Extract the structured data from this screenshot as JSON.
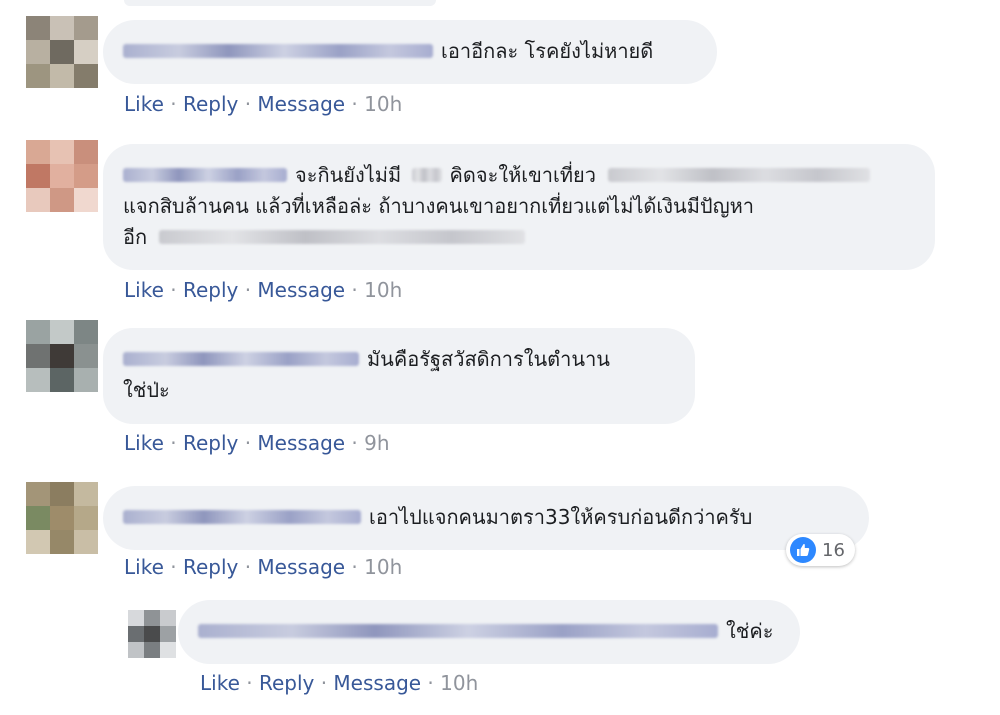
{
  "comments": [
    {
      "text_lines": [
        "เอาอีกละ โรคยังไม่หายดี"
      ],
      "actions": {
        "like": "Like",
        "reply": "Reply",
        "message": "Message",
        "time": "10h"
      }
    },
    {
      "text_lines": [
        "จะกินยังไม่มี",
        "คิดจะให้เขาเที่ยว",
        "แจกสิบล้านคน แล้วที่เหลือล่ะ ถ้าบางคนเขาอยากเที่ยวแต่ไม่ได้เงินมีปัญหา",
        "อีก"
      ],
      "actions": {
        "like": "Like",
        "reply": "Reply",
        "message": "Message",
        "time": "10h"
      }
    },
    {
      "text_lines": [
        "มันคือรัฐสวัสดิการในตำนาน",
        "ใช่ป่ะ"
      ],
      "actions": {
        "like": "Like",
        "reply": "Reply",
        "message": "Message",
        "time": "9h"
      }
    },
    {
      "text_lines": [
        "เอาไปแจกคนมาตรา33ให้ครบก่อนดีกว่าครับ"
      ],
      "reaction": {
        "icon": "thumbs-up-icon",
        "count": "16",
        "color": "#2d88ff"
      },
      "actions": {
        "like": "Like",
        "reply": "Reply",
        "message": "Message",
        "time": "10h"
      }
    },
    {
      "text_lines": [
        "ใช่ค่ะ"
      ],
      "actions": {
        "like": "Like",
        "reply": "Reply",
        "message": "Message",
        "time": "10h"
      }
    }
  ],
  "separator": " · ",
  "colors": {
    "link": "#385898",
    "meta": "#90949c",
    "bubble": "#f0f2f5",
    "text": "#1c1e21"
  }
}
